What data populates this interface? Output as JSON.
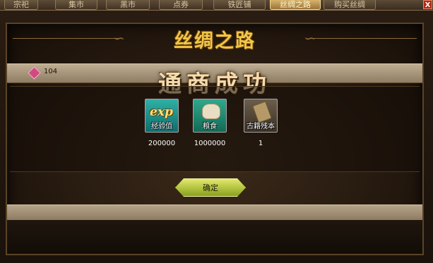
{
  "tabs": [
    "宗祀",
    "集市",
    "黑市",
    "点券",
    "铁匠铺",
    "丝绸之路",
    "购买丝绸"
  ],
  "active_tab_index": 5,
  "close_label": "X",
  "dialog": {
    "title": "丝绸之路",
    "currency_value": "104",
    "success_text": "通商成功",
    "items": [
      {
        "name": "经验值",
        "icon": "exp-icon",
        "count": "200000",
        "badge": "exp"
      },
      {
        "name": "粮食",
        "icon": "grain-sack-icon",
        "count": "1000000"
      },
      {
        "name": "古籍残本",
        "icon": "ancient-book-icon",
        "count": "1"
      }
    ],
    "confirm_label": "确定"
  },
  "colors": {
    "title_gold": "#f1c64a",
    "confirm_green": "#b9cf3f",
    "active_tab": "#d6b36d"
  }
}
